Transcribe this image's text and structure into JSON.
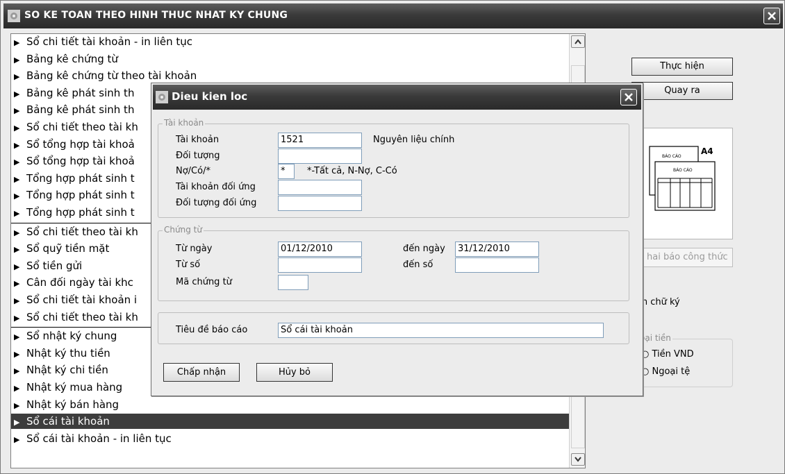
{
  "window": {
    "title": "SO KE TOAN THEO HINH THUC NHAT KY CHUNG"
  },
  "report_list": {
    "groups": [
      [
        "Sổ chi tiết tài khoản - in liên tục",
        "Bảng kê chứng từ",
        "Bảng kê chứng từ theo tài khoản",
        "Bảng kê phát sinh th",
        "Bảng kê phát sinh th",
        "Sổ chi tiết theo tài kh",
        "Sổ tổng hợp tài khoả",
        "Sổ tổng hợp tài khoả",
        "Tổng hợp phát sinh t",
        "Tổng hợp phát sinh t",
        "Tổng hợp phát sinh t"
      ],
      [
        "Sổ chi tiết theo tài kh",
        "Sổ quỹ tiền mặt",
        "Sổ tiền gửi",
        "Cân đối ngày tài khc",
        "Sổ chi tiết tài khoản i",
        "Sổ chi tiết theo tài kh"
      ],
      [
        "Sổ nhật ký chung",
        "Nhật ký thu tiền",
        "Nhật ký chi tiền",
        "Nhật ký mua hàng",
        "Nhật ký bán hàng",
        "Sổ cái tài khoản",
        "Sổ cái tài khoản - in liên tục"
      ]
    ],
    "selected": "Sổ cái tài khoản"
  },
  "right_panel": {
    "execute_label": "Thực hiện",
    "exit_label": "Quay ra",
    "preview_paper": "A4",
    "preview_caption": "BÁO CÁO",
    "formula_label": "hai báo công thức",
    "print_signature_label": "In chữ ký",
    "currency_group_title": "oại tiền",
    "currency_vnd_label": "Tiền VND",
    "currency_foreign_label": "Ngoại tệ"
  },
  "dialog": {
    "title": "Dieu kien loc",
    "account_group": {
      "legend": "Tài khoản",
      "account_label": "Tài khoản",
      "account_value": "1521",
      "account_name": "Nguyên liệu chính",
      "object_label": "Đối tượng",
      "object_value": "",
      "dc_label": "Nợ/Có/*",
      "dc_value": "*",
      "dc_hint": "*-Tất cả, N-Nợ, C-Có",
      "contra_account_label": "Tài khoản đối ứng",
      "contra_account_value": "",
      "contra_object_label": "Đối tượng đối ứng",
      "contra_object_value": ""
    },
    "voucher_group": {
      "legend": "Chứng từ",
      "from_date_label": "Từ ngày",
      "from_date_value": "01/12/2010",
      "to_date_label": "đến ngày",
      "to_date_value": "31/12/2010",
      "from_no_label": "Từ số",
      "from_no_value": "",
      "to_no_label": "đến số",
      "to_no_value": "",
      "voucher_code_label": "Mã chứng từ",
      "voucher_code_value": ""
    },
    "report_title_label": "Tiêu đề báo cáo",
    "report_title_value": "Sổ cái tài khoản",
    "accept_label": "Chấp nhận",
    "cancel_label": "Hủy bỏ"
  }
}
